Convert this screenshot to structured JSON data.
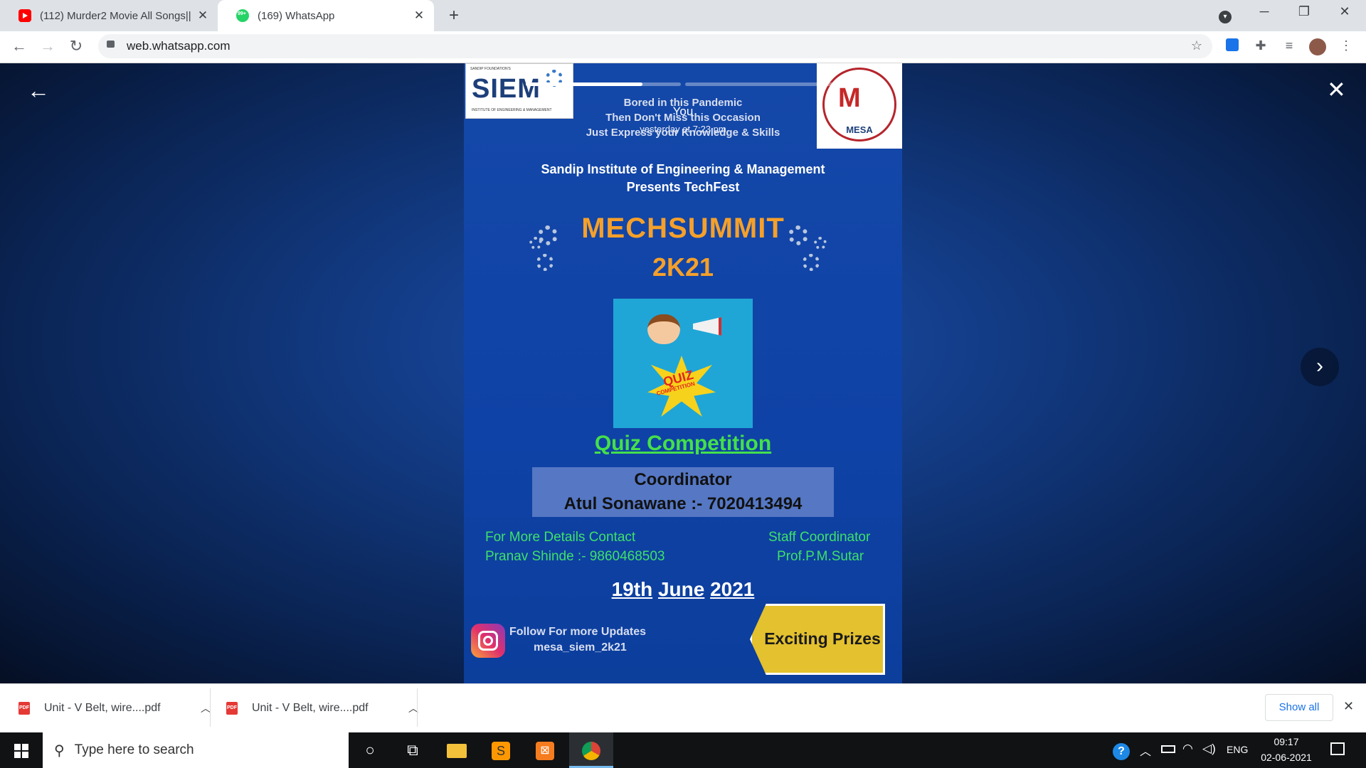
{
  "browser": {
    "tabs": [
      {
        "title": "(112) Murder2 Movie All Songs||",
        "favicon": "youtube-icon",
        "color": "#ff0000"
      },
      {
        "title": "(169) WhatsApp",
        "favicon": "whatsapp-icon",
        "color": "#25d366",
        "badge": "99+"
      }
    ],
    "url": "web.whatsapp.com"
  },
  "status": {
    "author": "You",
    "time": "yesterday at 7:23 pm"
  },
  "poster": {
    "logo_left": "SIEM",
    "logo_left_small_top": "SANDIP FOUNDATION'S",
    "logo_left_small_bottom": "INSTITUTE OF ENGINEERING & MANAGEMENT",
    "logo_right": "MESA",
    "tagline_1": "Bored in this Pandemic",
    "tagline_2": "Then Don't Miss this Occasion",
    "tagline_3": "Just Express your Knowledge & Skills",
    "presenter_1": "Sandip Institute of Engineering & Management",
    "presenter_2": "Presents TechFest",
    "event_title": "MECHSUMMIT",
    "event_year": "2K21",
    "quiz_badge_1": "QUIZ",
    "quiz_badge_2": "COMPETITION",
    "subtitle": "Quiz Competition",
    "coordinator_label": "Coordinator",
    "coordinator_name": "Atul Sonawane :- 7020413494",
    "contact_label": "For More Details Contact",
    "contact_value": "Pranav Shinde :- 9860468503",
    "staff_label": "Staff Coordinator",
    "staff_value": "Prof.P.M.Sutar",
    "date_day": "19th",
    "date_month": "June",
    "date_year": "2021",
    "follow_label": "Follow For more Updates",
    "follow_handle": "mesa_siem_2k21",
    "prize_label": "Exciting Prizes"
  },
  "downloads": {
    "items": [
      {
        "label": "Unit - V Belt,  wire....pdf"
      },
      {
        "label": "Unit - V Belt,  wire....pdf"
      }
    ],
    "show_all": "Show all"
  },
  "taskbar": {
    "search_placeholder": "Type here to search",
    "language": "ENG",
    "time": "09:17",
    "date": "02-06-2021"
  },
  "progress": {
    "segment_1": 0.75,
    "segment_2": 0.0,
    "segment_3": 0.0
  },
  "colors": {
    "accent_orange": "#f5a02a",
    "accent_green": "#44e04a",
    "prize_gold": "#e3c12f",
    "poster_blue": "#1448a8"
  }
}
